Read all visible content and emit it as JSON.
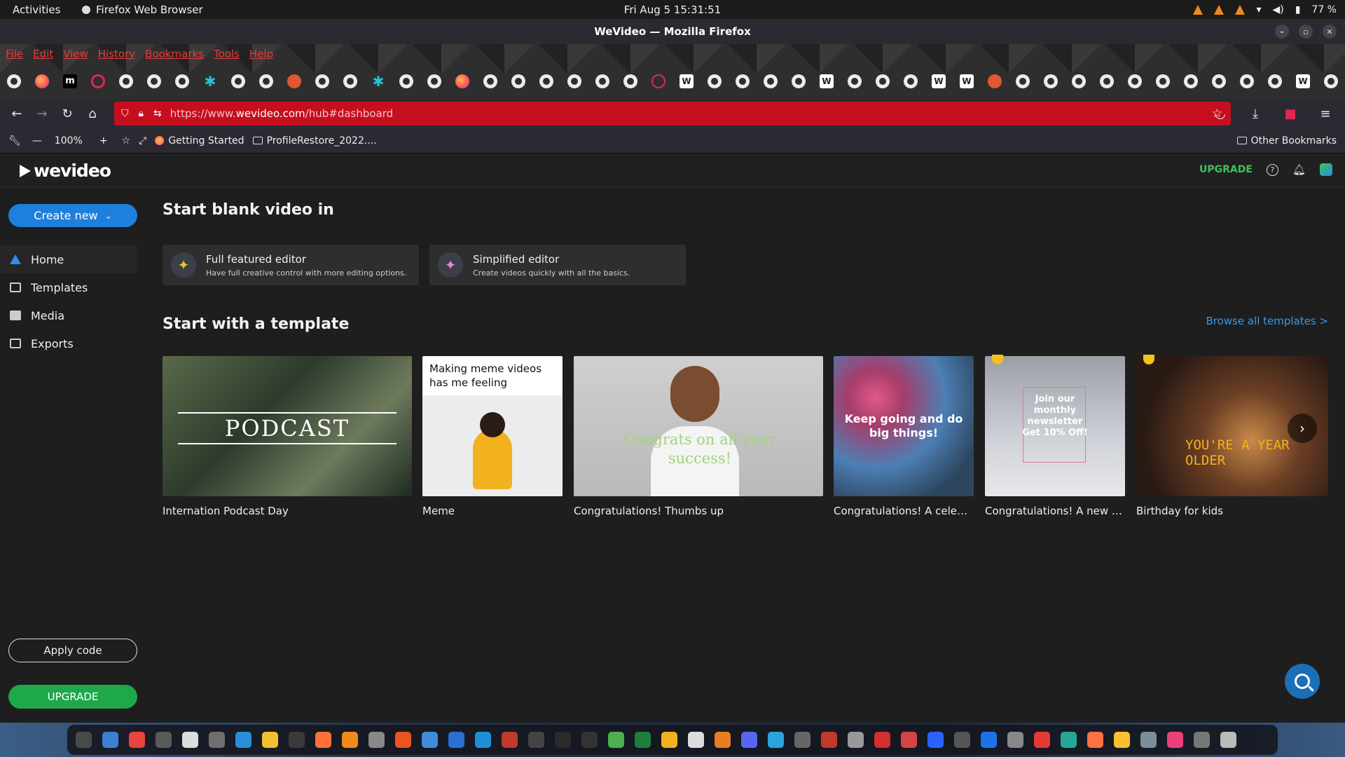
{
  "system_bar": {
    "activities": "Activities",
    "app_name": "Firefox Web Browser",
    "clock": "Fri Aug 5  15:31:51",
    "battery": "77 %"
  },
  "window": {
    "title": "WeVideo — Mozilla Firefox"
  },
  "menu": [
    "File",
    "Edit",
    "View",
    "History",
    "Bookmarks",
    "Tools",
    "Help"
  ],
  "tabs": [
    "gh",
    "ff",
    "m",
    "gear",
    "gh",
    "gh",
    "gh",
    "x",
    "gh",
    "gh",
    "ddg",
    "gh",
    "gh",
    "x",
    "gh",
    "gh",
    "ff",
    "gh",
    "gh",
    "gh",
    "gh",
    "gh",
    "gh",
    "globe",
    "w",
    "gh",
    "gh",
    "gh",
    "gh",
    "w",
    "gh",
    "gh",
    "gh",
    "w",
    "w",
    "ddg",
    "gh",
    "gh",
    "gh",
    "gh",
    "gh",
    "gh",
    "gh",
    "gh",
    "gh",
    "gh",
    "w",
    "gh"
  ],
  "address_bar": {
    "url_prefix": "https://www.",
    "url_domain": "wevideo.com",
    "url_path": "/hub#dashboard"
  },
  "bookmarks_bar": {
    "zoom": "100%",
    "items": [
      "Getting Started",
      "ProfileRestore_2022...."
    ],
    "other": "Other Bookmarks"
  },
  "app": {
    "logo": "wevideo",
    "upgrade_link": "UPGRADE",
    "create_new": "Create new",
    "nav": [
      {
        "label": "Home",
        "icon": "home-icon"
      },
      {
        "label": "Templates",
        "icon": "templates-icon"
      },
      {
        "label": "Media",
        "icon": "media-icon"
      },
      {
        "label": "Exports",
        "icon": "exports-icon"
      }
    ],
    "apply_code": "Apply code",
    "upgrade_button": "UPGRADE"
  },
  "main": {
    "blank_title": "Start blank video in",
    "editors": [
      {
        "title": "Full featured editor",
        "desc": "Have full creative control with more editing options."
      },
      {
        "title": "Simplified editor",
        "desc": "Create videos quickly with all the basics."
      }
    ],
    "template_title": "Start with a template",
    "browse_all": "Browse all templates >",
    "templates": [
      {
        "caption": "Internation Podcast Day",
        "overlay": "PODCAST",
        "premium": false
      },
      {
        "caption": "Meme",
        "overlay": "Making meme videos has me feeling",
        "premium": false
      },
      {
        "caption": "Congratulations! Thumbs up",
        "overlay": "Congrats on all your success!",
        "premium": false
      },
      {
        "caption": "Congratulations! A celebr...",
        "overlay": "Keep going and do big things!",
        "premium": false
      },
      {
        "caption": "Congratulations! A new b...",
        "overlay": "Join our monthly newsletter Get 10% Off!",
        "premium": true
      },
      {
        "caption": "Birthday for kids",
        "overlay": "YOU'RE A YEAR OLDER",
        "premium": true
      }
    ]
  },
  "colors": {
    "url_bar": "#c50f1f",
    "primary_blue": "#1f7fdc",
    "upgrade_green": "#1ea84a"
  }
}
